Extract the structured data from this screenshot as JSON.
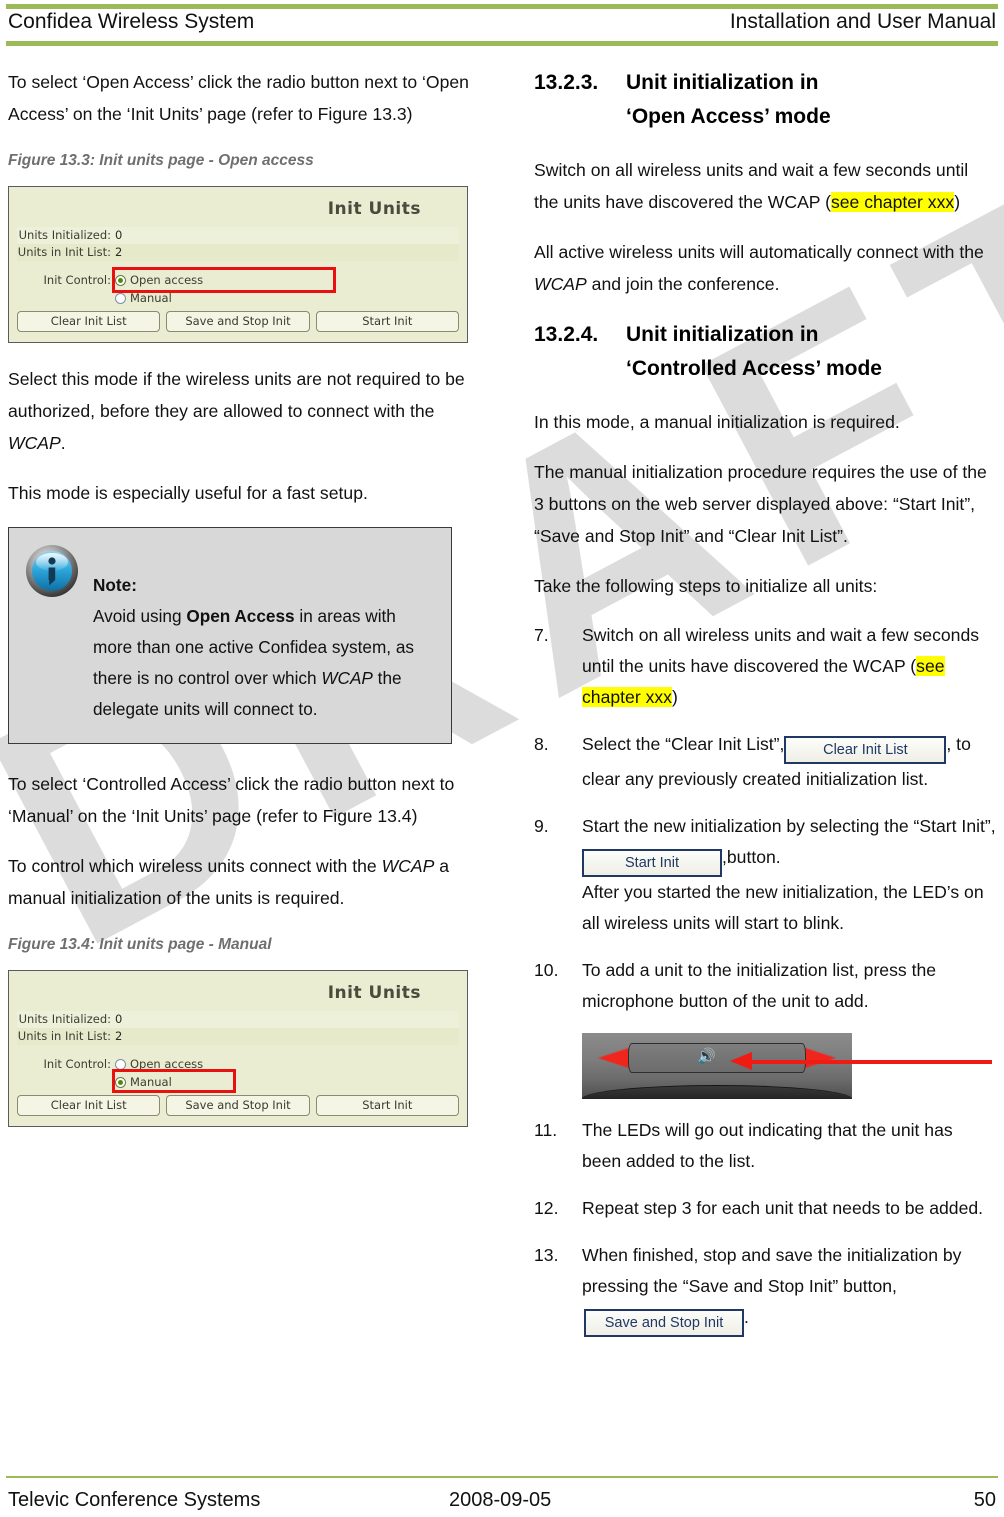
{
  "header": {
    "left": "Confidea Wireless System",
    "right": "Installation and User Manual",
    "rule_color": "#9BBB59"
  },
  "footer": {
    "left": "Televic Conference Systems",
    "center": "2008-09-05",
    "page_number": "50",
    "rule_color": "#9BBB59"
  },
  "watermark": {
    "text": "DRAFT",
    "color": "#DCDCDC"
  },
  "left_column": {
    "intro_paragraph": "To select ‘Open Access’ click the radio button next to ‘Open Access’ on the ‘Init Units’ page (refer to  Figure 13.3)",
    "figure_13_3_caption": "Figure 13.3: Init units page - Open access",
    "after_fig1_para1_a": "Select this mode if the wireless units are not required to be authorized, before they are allowed to connect with the ",
    "after_fig1_para1_italic": "WCAP",
    "after_fig1_para1_b": ".",
    "after_fig1_para2": "This mode is especially useful for a fast setup.",
    "note": {
      "icon": "info-icon",
      "title": "Note:",
      "text_a": "Avoid using ",
      "text_bold": "Open Access",
      "text_b": " in areas with more than one active Confidea system, as there is no control over which ",
      "text_italic": "WCAP",
      "text_c": " the delegate units will connect to."
    },
    "controlled_access_para": "To select ‘Controlled Access’ click the radio button next to ‘Manual’ on the ‘Init Units’ page (refer to Figure 13.4)",
    "control_para_a": "To control which wireless units connect with the ",
    "control_para_italic": "WCAP",
    "control_para_b": " a manual initialization of the units is required.",
    "figure_13_4_caption": "Figure 13.4: Init units page - Manual"
  },
  "init_units_figure_1": {
    "title": "Init Units",
    "rows": [
      {
        "label": "Units Initialized:",
        "value": "0"
      },
      {
        "label": "Units in Init List:",
        "value": "2"
      }
    ],
    "control_label": "Init Control:",
    "options": [
      {
        "label": "Open access",
        "selected": true
      },
      {
        "label": "Manual",
        "selected": false
      }
    ],
    "buttons": [
      "Clear Init List",
      "Save and Stop Init",
      "Start Init"
    ],
    "highlight_target": "Open access",
    "highlight_color": "#E8110F",
    "panel_bg": "#EAEDD2"
  },
  "init_units_figure_2": {
    "title": "Init Units",
    "rows": [
      {
        "label": "Units Initialized:",
        "value": "0"
      },
      {
        "label": "Units in Init List:",
        "value": "2"
      }
    ],
    "control_label": "Init Control:",
    "options": [
      {
        "label": "Open access",
        "selected": false
      },
      {
        "label": "Manual",
        "selected": true
      }
    ],
    "buttons": [
      "Clear Init List",
      "Save and Stop Init",
      "Start Init"
    ],
    "highlight_target": "Manual",
    "highlight_color": "#E8110F",
    "panel_bg": "#EAEDD2"
  },
  "right_column": {
    "section_13_2_3": {
      "number": "13.2.3.",
      "line1": "Unit initialization in",
      "line2": "‘Open Access’ mode"
    },
    "para_switch_on_a": "Switch on all wireless units and wait a few seconds until the units have discovered the WCAP (",
    "para_switch_on_hl": "see chapter xxx",
    "para_switch_on_b": ")",
    "para_all_active_a": "All active wireless units will automatically connect with the ",
    "para_all_active_italic": "WCAP",
    "para_all_active_b": " and join the conference.",
    "section_13_2_4": {
      "number": "13.2.4.",
      "line1": "Unit initialization in",
      "line2": "‘Controlled Access’ mode"
    },
    "para_in_this_mode": "In this mode, a manual initialization is required.",
    "para_manual_proc": "The manual initialization procedure requires the use of the 3 buttons on the web server displayed above: “Start Init”, “Save and Stop Init” and “Clear Init List”.",
    "para_take_steps": "Take the following steps to initialize all units:",
    "steps": [
      {
        "n": "7.",
        "text_a": "Switch on all wireless units and wait a few seconds until the units have discovered the WCAP (",
        "highlight": "see chapter xxx",
        "text_b": ")"
      },
      {
        "n": "8.",
        "text_a": "Select the “Clear Init List”,",
        "button": "Clear Init List",
        "text_b": ", to clear any previously created initialization list."
      },
      {
        "n": "9.",
        "text_a": "Start the new initialization by selecting the “Start Init”, ",
        "button": "Start Init",
        "text_b": ",button.",
        "text_c": "After you started the new initialization, the LED’s on all wireless units will start to blink."
      },
      {
        "n": "10.",
        "text_a": "To add a unit to the initialization list, press the microphone button of the unit to add."
      },
      {
        "n": "11.",
        "text_a": "The LEDs will go out indicating that the unit has been added to the list."
      },
      {
        "n": "12.",
        "text_a": "Repeat step 3 for each unit that needs to be added."
      },
      {
        "n": "13.",
        "text_a": "When finished, stop and save the initialization by pressing the “Save and Stop Init” button,",
        "button": "Save and Stop Init",
        "text_b": "."
      }
    ],
    "unit_photo": {
      "name": "wireless-unit-microphone-photo",
      "led_color": "#F0251C",
      "arrow_color": "#EE1C12"
    }
  }
}
